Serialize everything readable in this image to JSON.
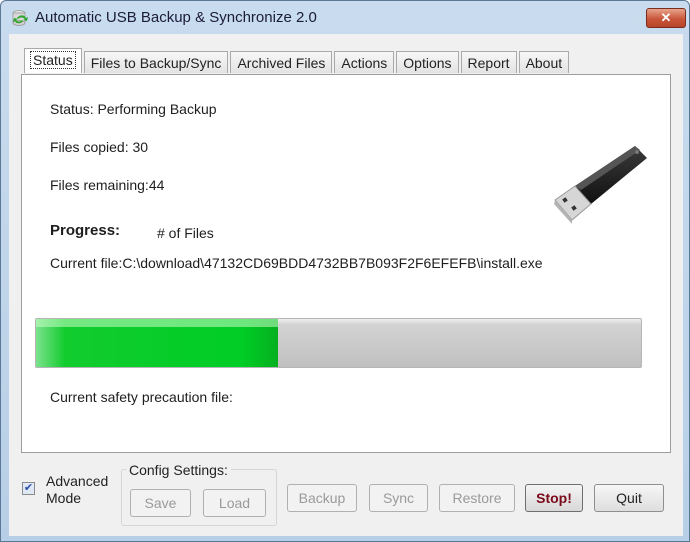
{
  "window": {
    "title": "Automatic USB Backup & Synchronize 2.0",
    "close_label": "✕"
  },
  "tabs": [
    {
      "label": "Status",
      "active": true
    },
    {
      "label": "Files to Backup/Sync",
      "active": false
    },
    {
      "label": "Archived Files",
      "active": false
    },
    {
      "label": "Actions",
      "active": false
    },
    {
      "label": "Options",
      "active": false
    },
    {
      "label": "Report",
      "active": false
    },
    {
      "label": "About",
      "active": false
    }
  ],
  "status": {
    "status_text": "Status: Performing Backup",
    "files_copied": "Files copied: 30",
    "files_remaining": "Files remaining:44",
    "progress_label": "Progress:",
    "progress_mode": "# of Files",
    "current_file": "Current file:C:\\download\\47132CD69BDD4732BB7B093F2F6EFEFB\\install.exe",
    "progress_fraction": 0.4,
    "safety_file": "Current safety precaution file:",
    "usb_icon": "usb-drive-icon"
  },
  "bottom": {
    "advanced_mode_checked": true,
    "advanced_mode_label_1": "Advanced",
    "advanced_mode_label_2": "Mode",
    "config_title": "Config Settings:",
    "save_label": "Save",
    "load_label": "Load",
    "backup_label": "Backup",
    "sync_label": "Sync",
    "restore_label": "Restore",
    "stop_label": "Stop!",
    "quit_label": "Quit"
  },
  "colors": {
    "progress_fill": "#00cd25",
    "progress_track": "#c9c9c9",
    "stop_text": "#7a0a1a",
    "close_button": "#c9563a"
  }
}
